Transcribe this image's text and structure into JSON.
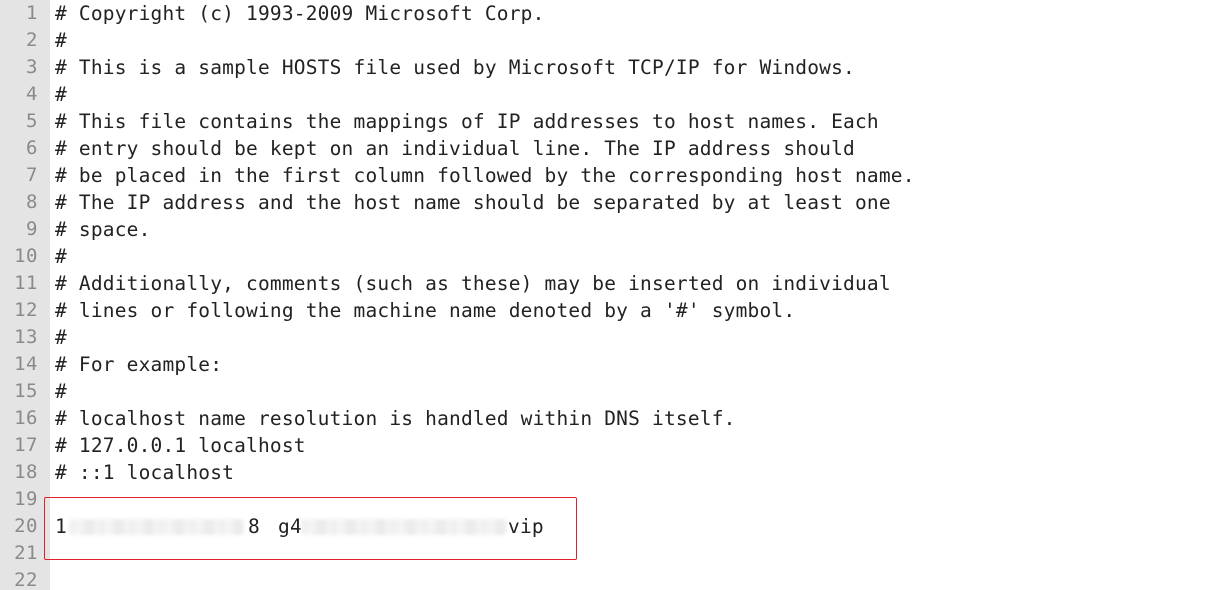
{
  "editor": {
    "line_numbers": [
      "1",
      "2",
      "3",
      "4",
      "5",
      "6",
      "7",
      "8",
      "9",
      "10",
      "11",
      "12",
      "13",
      "14",
      "15",
      "16",
      "17",
      "18",
      "19",
      "20",
      "21",
      "22"
    ],
    "lines": [
      "# Copyright (c) 1993-2009 Microsoft Corp.",
      "#",
      "# This is a sample HOSTS file used by Microsoft TCP/IP for Windows.",
      "#",
      "# This file contains the mappings of IP addresses to host names. Each",
      "# entry should be kept on an individual line. The IP address should",
      "# be placed in the first column followed by the corresponding host name.",
      "# The IP address and the host name should be separated by at least one",
      "# space.",
      "#",
      "# Additionally, comments (such as these) may be inserted on individual",
      "# lines or following the machine name denoted by a '#' symbol.",
      "#",
      "# For example:",
      "#",
      "# localhost name resolution is handled within DNS itself.",
      "# 127.0.0.1 localhost",
      "# ::1 localhost",
      "",
      "",
      "",
      ""
    ],
    "entry_line": {
      "ip_start": "1",
      "ip_end": "8",
      "host_start": "g4",
      "host_end": "vip"
    }
  },
  "colors": {
    "highlight_border": "#e0202a",
    "gutter_background": "#e4e4e4",
    "line_number_color": "#8a8a8a",
    "text_color": "#222222"
  }
}
